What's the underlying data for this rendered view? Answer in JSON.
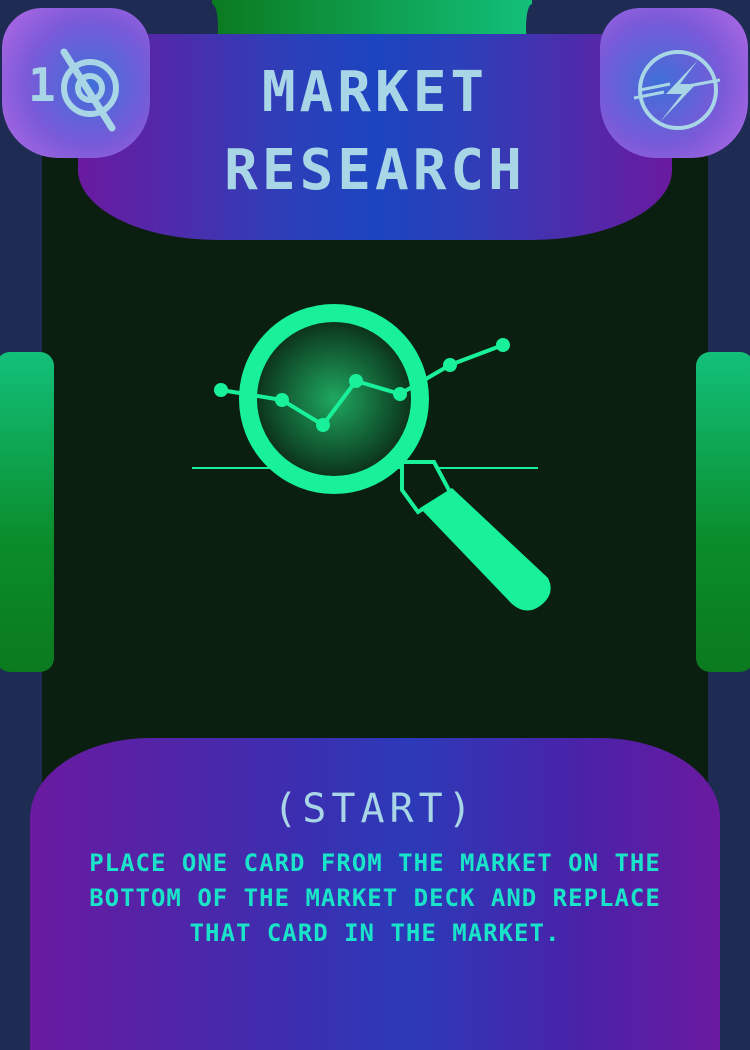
{
  "card": {
    "title_line1": "MARKET",
    "title_line2": "RESEARCH",
    "cost": "1",
    "timing": "(START)",
    "rules_text": "PLACE ONE CARD FROM THE MARKET ON THE BOTTOM OF THE MARKET DECK AND REPLACE THAT CARD IN THE MARKET.",
    "top_left_icon": "cost-disc-icon",
    "top_right_icon": "lightning-bolt-icon",
    "illustration": "magnifying-glass-over-line-chart-icon"
  },
  "colors": {
    "frame": "#1e2b52",
    "art_background": "#0b1f10",
    "accent_green": "#19f09a",
    "text_light_blue": "#a9d6e6",
    "rules_text": "#19e3c8",
    "banner_purple": "#6a1aa0",
    "banner_blue": "#1c44c0"
  }
}
